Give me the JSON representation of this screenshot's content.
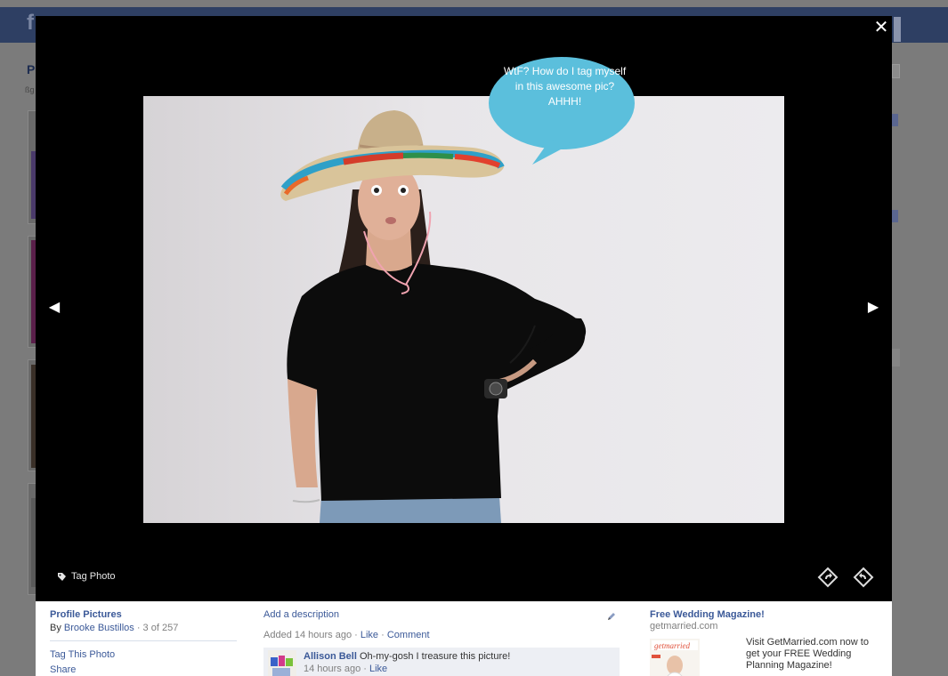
{
  "background": {
    "logo": "f",
    "title_fragment": "P",
    "sub_fragment": "ßg"
  },
  "viewer": {
    "close_label": "✕",
    "prev_label": "◀",
    "next_label": "▶",
    "tag_photo_label": "Tag Photo",
    "bubble_text": "WtF? How do I tag myself in this awesome pic? AHHH!",
    "bubble_color": "#5bbfdc"
  },
  "info": {
    "album_title": "Profile Pictures",
    "by_label": "By",
    "owner_name": "Brooke Bustillos",
    "position": " · 3 of 257",
    "actions": [
      "Tag This Photo",
      "Share"
    ],
    "add_description": "Add a description",
    "added_time": "Added 14 hours ago",
    "like_label": "Like",
    "comment_label": "Comment",
    "meta_sep": " · ",
    "comment": {
      "author": "Allison Bell",
      "text": "Oh-my-gosh I treasure this picture!",
      "time": "14 hours ago",
      "like_label": "Like"
    },
    "ad": {
      "title": "Free Wedding Magazine!",
      "domain": "getmarried.com",
      "body": "Visit GetMarried.com now to get your FREE Wedding Planning Magazine!",
      "image_logo": "getmarried"
    }
  },
  "colors": {
    "facebook_blue": "#3b5998",
    "overlay": "#000000",
    "comment_bg": "#edeff4"
  }
}
